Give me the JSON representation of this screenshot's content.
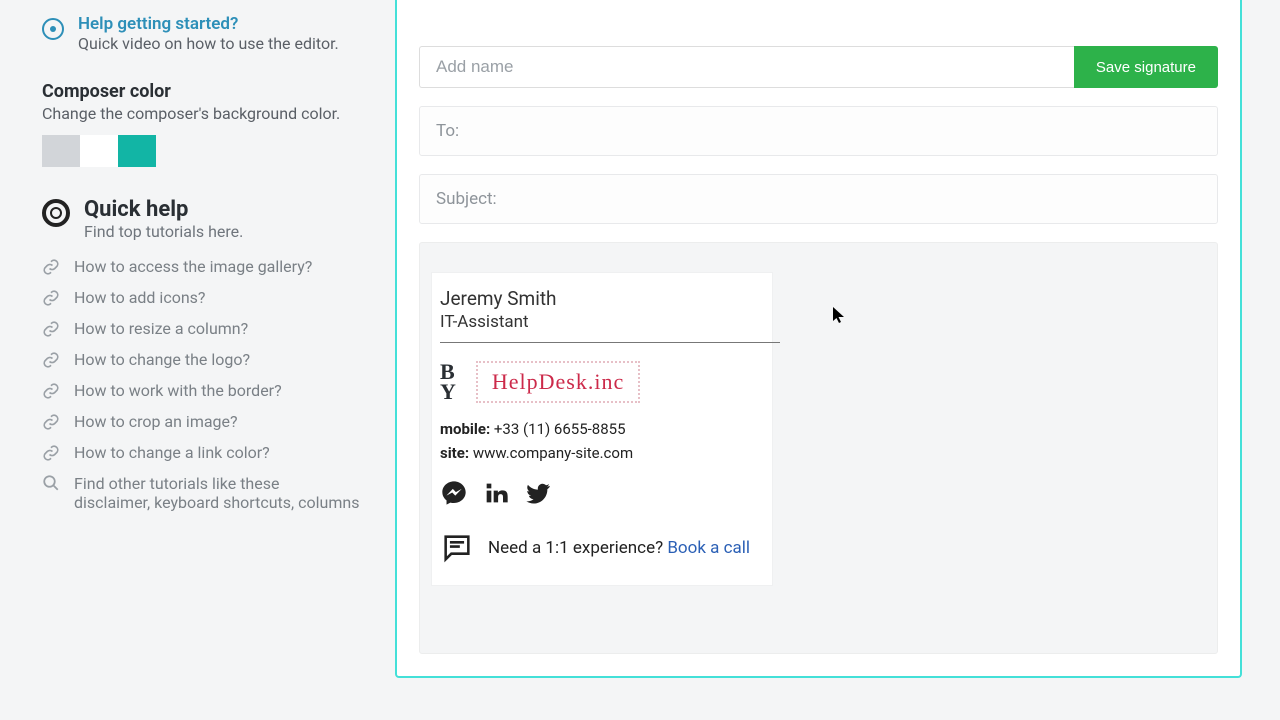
{
  "sidebar": {
    "help_start": {
      "title": "Help getting started?",
      "subtitle": "Quick video on how to use the editor."
    },
    "composer_color": {
      "heading": "Composer color",
      "desc": "Change the composer's background color."
    },
    "quick_help": {
      "heading": "Quick help",
      "desc": "Find top tutorials here."
    },
    "links": [
      "How to access the image gallery?",
      "How to add icons?",
      "How to resize a column?",
      "How to change the logo?",
      "How to work with the border?",
      "How to crop an image?",
      "How to change a link color?"
    ],
    "search_line": "Find other tutorials like these",
    "search_sub": "disclaimer, keyboard shortcuts, columns"
  },
  "composer": {
    "name_placeholder": "Add name",
    "save_label": "Save signature",
    "to_label": "To:",
    "subject_label": "Subject:"
  },
  "signature": {
    "name": "Jeremy Smith",
    "title": "IT-Assistant",
    "logo_mark_line1": "B",
    "logo_mark_line2": "Y",
    "company": "HelpDesk.inc",
    "mobile_label": "mobile:",
    "mobile_value": "+33 (11) 6655-8855",
    "site_label": "site:",
    "site_value": "www.company-site.com",
    "cta_text": "Need a 1:1 experience? ",
    "cta_link": "Book a call"
  }
}
